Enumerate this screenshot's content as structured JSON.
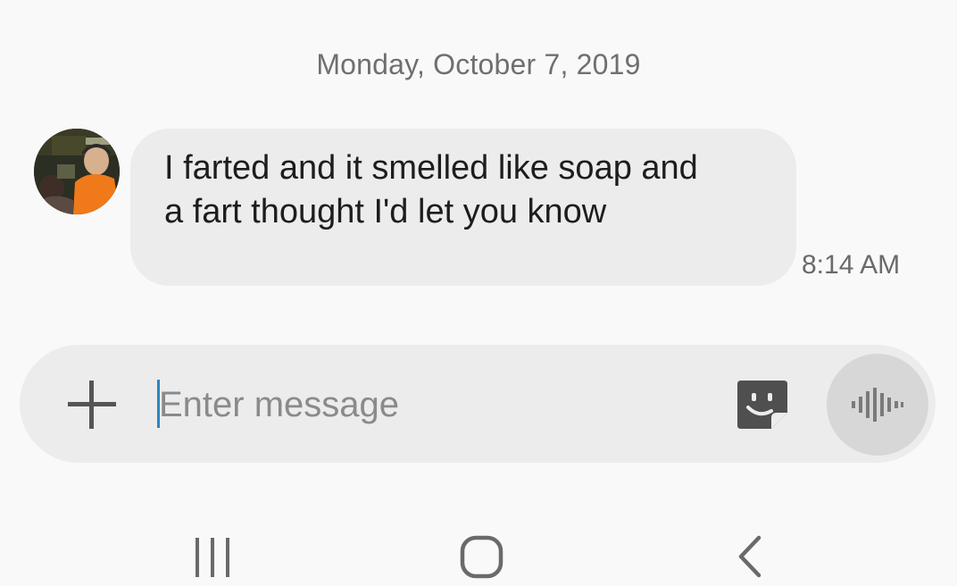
{
  "conversation": {
    "date_header": "Monday, October 7, 2019",
    "messages": [
      {
        "direction": "incoming",
        "text": "I farted and it smelled like soap and\na fart thought I'd let you know",
        "time": "8:14 AM"
      }
    ]
  },
  "composer": {
    "placeholder": "Enter message",
    "value": "",
    "icons": {
      "attach": "plus-icon",
      "sticker": "sticker-icon",
      "voice": "voice-recorder-icon"
    }
  },
  "navigation_bar": {
    "icons": [
      "recent-apps-icon",
      "home-icon",
      "back-icon"
    ]
  },
  "colors": {
    "background": "#f9f9f9",
    "bubble": "#ececec",
    "composer": "#ececec",
    "voice_button": "#d7d7d7",
    "cursor": "#2e86c1",
    "secondary_text": "#6f6f6f"
  }
}
